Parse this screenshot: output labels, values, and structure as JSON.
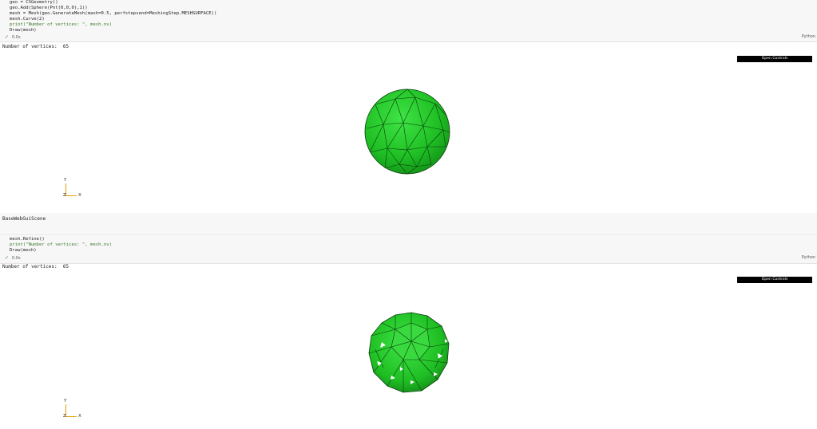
{
  "cell1": {
    "code": [
      "geo = CSGeometry()",
      "geo.Add(Sphere(Pnt(0,0,0),1))",
      "mesh = Mesh(geo.GenerateMesh(maxh=0.5, perfstepsend=MeshingStep.MESHSURFACE))",
      "mesh.Curve(2)",
      "print(\"Number of vertices: \", mesh.nv)",
      "Draw(mesh)"
    ],
    "status": "0.0s",
    "language": "Python"
  },
  "output1": {
    "text": "Number of vertices:  65",
    "open_controls": "Open Controls",
    "axis_y": "Y",
    "axis_z": "Z",
    "axis_x": "X"
  },
  "scene_label": "BaseWebGuiScene",
  "cell2": {
    "code": [
      "mesh.Refine()",
      "print(\"Number of vertices: \", mesh.nv)",
      "Draw(mesh)"
    ],
    "status": "0.0s",
    "language": "Python"
  },
  "output2": {
    "text": "Number of vertices:  65",
    "open_controls": "Open Controls",
    "axis_y": "Y",
    "axis_z": "Z",
    "axis_x": "X"
  },
  "colors": {
    "mesh_green": "#22c62a",
    "axis_orange": "#e0a000",
    "cell_bg": "#f7f7f7"
  }
}
